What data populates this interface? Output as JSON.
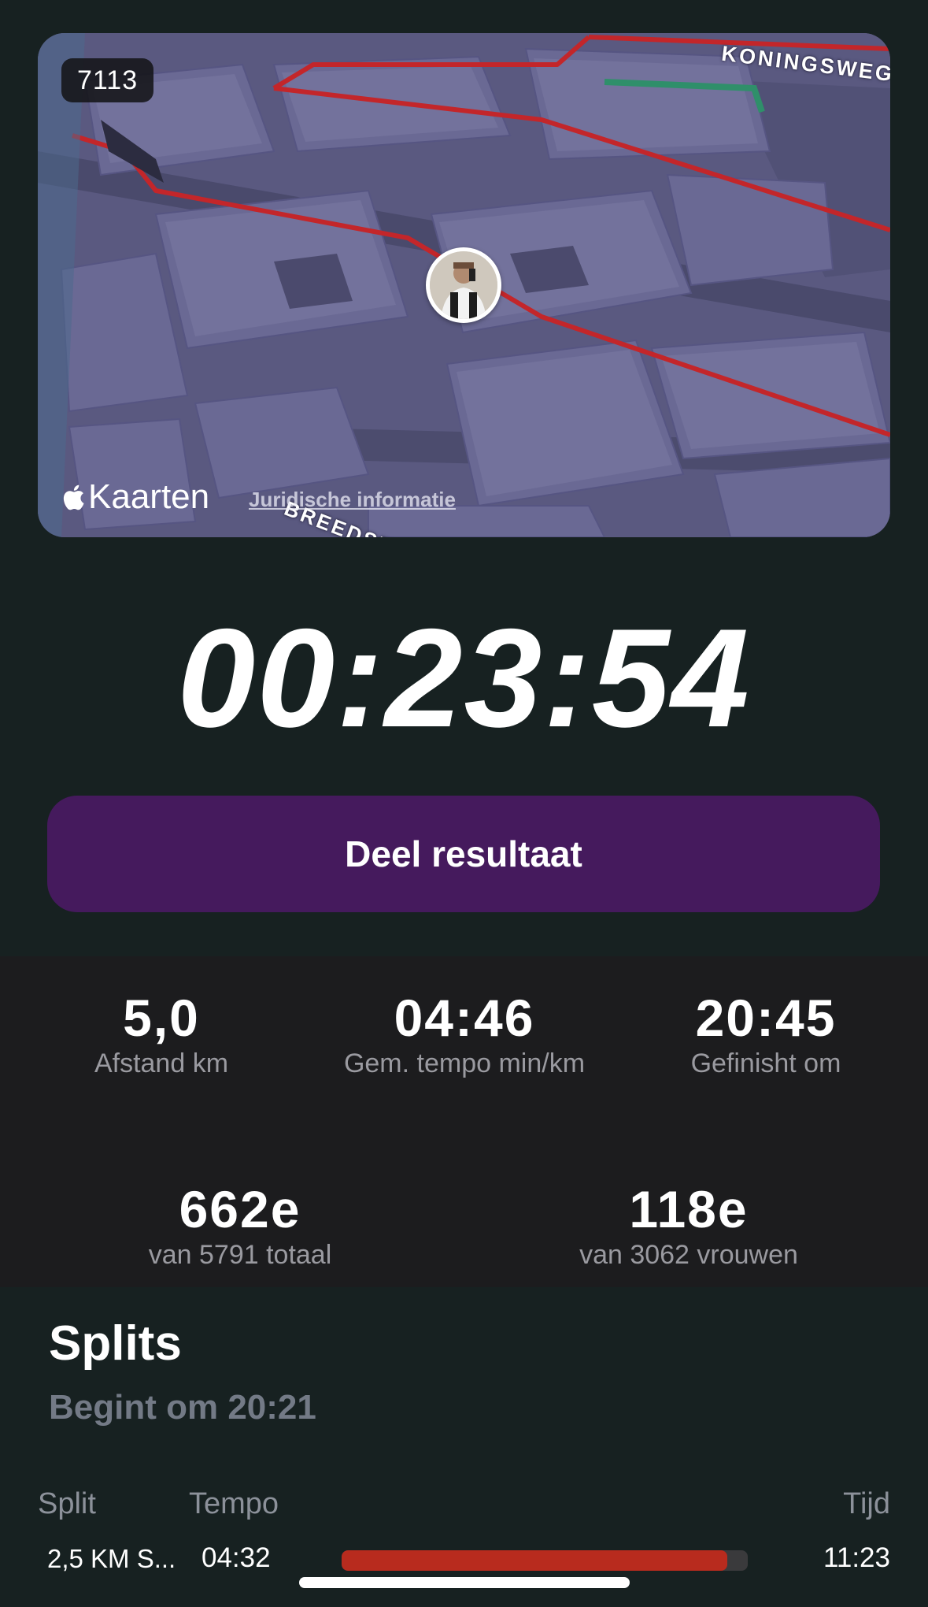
{
  "map": {
    "bib_number": "7113",
    "street_top": "KONINGSWEG",
    "street_bottom": "BREEDSTRAAT",
    "brand": "Kaarten",
    "legal_link": "Juridische informatie",
    "route_color": "#c3262a",
    "highlight_color": "#2f8f6a"
  },
  "result": {
    "time": "00:23:54",
    "share_label": "Deel resultaat",
    "accent_color": "#451a5d"
  },
  "stats": {
    "distance": {
      "value": "5,0",
      "label": "Afstand km"
    },
    "pace": {
      "value": "04:46",
      "label": "Gem. tempo min/km"
    },
    "finished": {
      "value": "20:45",
      "label": "Gefinisht om"
    },
    "overall_rank": {
      "value": "662e",
      "label": "van 5791 totaal"
    },
    "women_rank": {
      "value": "118e",
      "label": "van 3062 vrouwen"
    }
  },
  "splits": {
    "title": "Splits",
    "subtitle": "Begint om 20:21",
    "columns": {
      "split": "Split",
      "tempo": "Tempo",
      "time": "Tijd"
    },
    "rows": [
      {
        "name": "2,5 KM S...",
        "tempo": "04:32",
        "time": "11:23",
        "bar_fraction": 0.95
      }
    ]
  }
}
